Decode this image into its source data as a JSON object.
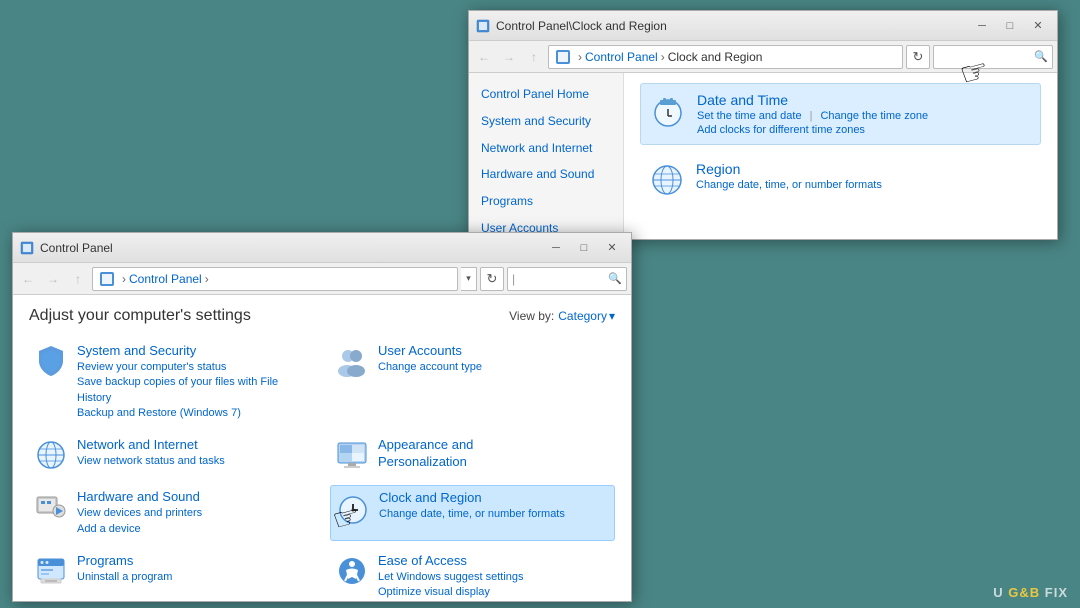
{
  "desktop": {
    "background_color": "#4a8585"
  },
  "watermark": {
    "text": "U   FIX",
    "highlighted": "G&B"
  },
  "cp_window": {
    "title": "Control Panel",
    "title_bar_icon": "⚙",
    "heading": "Adjust your computer's settings",
    "view_by_label": "View by:",
    "view_by_value": "Category",
    "address": {
      "path_parts": [
        "Control Panel",
        ">"
      ],
      "search_placeholder": "|"
    },
    "controls": {
      "minimize": "─",
      "maximize": "□",
      "close": "✕"
    },
    "categories": [
      {
        "id": "system-security",
        "title": "System and Security",
        "subtitle": "Review your computer's status",
        "subtitle2": "Save backup copies of your files with File History",
        "subtitle3": "Backup and Restore (Windows 7)",
        "highlighted": false
      },
      {
        "id": "user-accounts",
        "title": "User Accounts",
        "subtitle": "Change account type",
        "highlighted": false
      },
      {
        "id": "network-internet",
        "title": "Network and Internet",
        "subtitle": "View network status and tasks",
        "highlighted": false
      },
      {
        "id": "appearance",
        "title": "Appearance and Personalization",
        "highlighted": false
      },
      {
        "id": "hardware-sound",
        "title": "Hardware and Sound",
        "subtitle": "View devices and printers",
        "subtitle2": "Add a device",
        "highlighted": false
      },
      {
        "id": "clock-region",
        "title": "Clock and Region",
        "subtitle": "Change date, time, or number formats",
        "highlighted": true
      },
      {
        "id": "programs",
        "title": "Programs",
        "subtitle": "Uninstall a program",
        "highlighted": false
      },
      {
        "id": "ease-of-access",
        "title": "Ease of Access",
        "subtitle": "Let Windows suggest settings",
        "subtitle2": "Optimize visual display",
        "highlighted": false
      }
    ]
  },
  "cr_window": {
    "title": "Control Panel\\Clock and Region",
    "title_bar_icon": "⚙",
    "controls": {
      "minimize": "─",
      "maximize": "□",
      "close": "✕"
    },
    "address": {
      "breadcrumb": [
        "Control Panel",
        "Clock and Region"
      ]
    },
    "sidebar": {
      "items": [
        "Control Panel Home",
        "System and Security",
        "Network and Internet",
        "Hardware and Sound",
        "Programs",
        "User Accounts"
      ]
    },
    "items": [
      {
        "id": "date-time",
        "title": "Date and Time",
        "links": [
          "Set the time and date",
          "Change the time zone",
          "Add clocks for different time zones"
        ],
        "highlighted": true
      },
      {
        "id": "region",
        "title": "Region",
        "links": [
          "Change date, time, or number formats"
        ],
        "highlighted": false
      }
    ]
  },
  "cursor": {
    "hand_emoji": "👆"
  }
}
